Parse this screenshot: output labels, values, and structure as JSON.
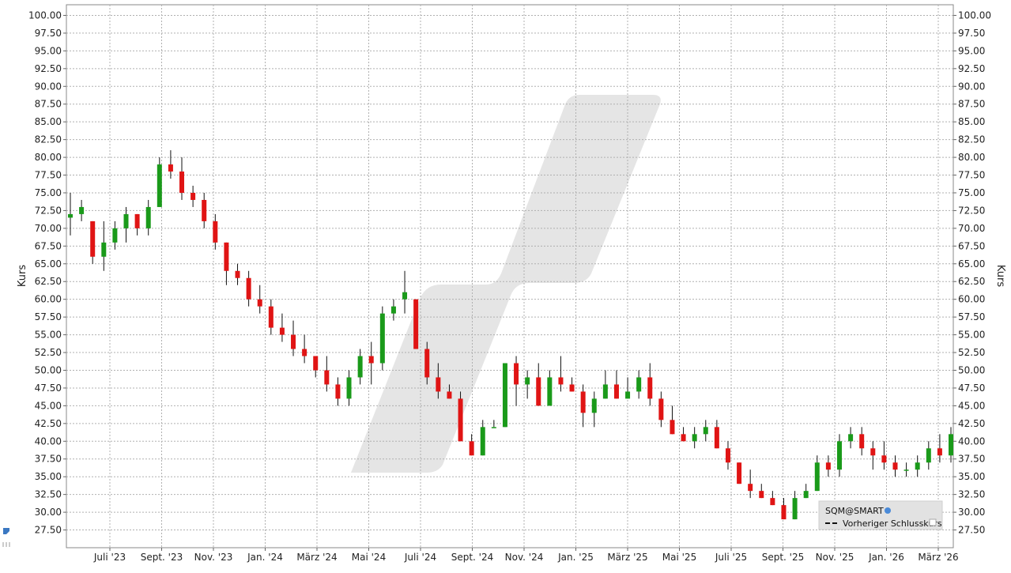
{
  "chart_data": {
    "type": "candlestick",
    "ylabel": "Kurs",
    "ylim": [
      25,
      101.5
    ],
    "y_ticks": [
      "27.50",
      "30.00",
      "32.50",
      "35.00",
      "37.50",
      "40.00",
      "42.50",
      "45.00",
      "47.50",
      "50.00",
      "52.50",
      "55.00",
      "57.50",
      "60.00",
      "62.50",
      "65.00",
      "67.50",
      "70.00",
      "72.50",
      "75.00",
      "77.50",
      "80.00",
      "82.50",
      "85.00",
      "87.50",
      "90.00",
      "92.50",
      "95.00",
      "97.50",
      "100.00"
    ],
    "x_ticks": [
      "Juli '23",
      "Sept. '23",
      "Nov. '23",
      "Jan. '24",
      "März '24",
      "Mai '24",
      "Juli '24",
      "Sept. '24",
      "Nov. '24",
      "Jan. '25",
      "März '25",
      "Mai '25",
      "Juli '25",
      "Sept. '25",
      "Nov. '25",
      "Jan. '26",
      "März '26"
    ],
    "grid": true,
    "legend": {
      "position": "bottom-right",
      "symbol": "SQM@SMART",
      "prev_close_label": "Vorheriger Schlusskurs"
    },
    "colors": {
      "up": "#1a9a1a",
      "down": "#e01414",
      "wick": "#111111",
      "grid": "#b0b0b0"
    },
    "candles": [
      [
        71.5,
        75,
        69,
        72
      ],
      [
        72,
        74,
        71,
        73
      ],
      [
        71,
        71,
        65,
        66
      ],
      [
        66,
        71,
        64,
        68
      ],
      [
        68,
        71,
        67,
        70
      ],
      [
        70,
        73,
        68,
        72
      ],
      [
        72,
        72,
        69,
        70
      ],
      [
        70,
        74,
        69,
        73
      ],
      [
        73,
        80,
        73,
        79
      ],
      [
        79,
        81,
        77,
        78
      ],
      [
        78,
        80,
        74,
        75
      ],
      [
        75,
        76,
        73,
        74
      ],
      [
        74,
        75,
        70,
        71
      ],
      [
        71,
        72,
        67,
        68
      ],
      [
        68,
        68,
        62,
        64
      ],
      [
        64,
        65,
        62,
        63
      ],
      [
        63,
        64,
        59,
        60
      ],
      [
        60,
        62,
        58,
        59
      ],
      [
        59,
        60,
        55,
        56
      ],
      [
        56,
        58,
        54,
        55
      ],
      [
        55,
        57,
        52,
        53
      ],
      [
        53,
        55,
        51,
        52
      ],
      [
        52,
        52,
        49,
        50
      ],
      [
        50,
        52,
        47,
        48
      ],
      [
        48,
        49,
        45,
        46
      ],
      [
        46,
        50,
        45,
        49
      ],
      [
        49,
        53,
        48,
        52
      ],
      [
        52,
        54,
        48,
        51
      ],
      [
        51,
        59,
        50,
        58
      ],
      [
        58,
        60,
        57,
        59
      ],
      [
        60,
        64,
        58,
        61
      ],
      [
        60,
        60,
        53,
        53
      ],
      [
        53,
        54,
        48,
        49
      ],
      [
        49,
        51,
        46,
        47
      ],
      [
        47,
        48,
        46,
        46
      ],
      [
        46,
        47,
        40,
        40
      ],
      [
        40,
        41,
        38,
        38
      ],
      [
        38,
        43,
        38,
        42
      ],
      [
        42,
        43,
        42,
        42
      ],
      [
        42,
        51,
        42,
        51
      ],
      [
        51,
        52,
        45,
        48
      ],
      [
        48,
        50,
        46,
        49
      ],
      [
        49,
        51,
        45,
        45
      ],
      [
        45,
        50,
        45,
        49
      ],
      [
        49,
        52,
        47,
        48
      ],
      [
        48,
        49,
        47,
        47
      ],
      [
        47,
        48,
        42,
        44
      ],
      [
        44,
        47,
        42,
        46
      ],
      [
        46,
        50,
        46,
        48
      ],
      [
        48,
        50,
        46,
        46
      ],
      [
        46,
        49,
        46,
        47
      ],
      [
        47,
        50,
        46,
        49
      ],
      [
        49,
        51,
        45,
        46
      ],
      [
        46,
        47,
        42,
        43
      ],
      [
        43,
        45,
        41,
        41
      ],
      [
        41,
        42,
        40,
        40
      ],
      [
        40,
        42,
        39,
        41
      ],
      [
        41,
        43,
        40,
        42
      ],
      [
        42,
        43,
        39,
        39
      ],
      [
        39,
        40,
        36,
        37
      ],
      [
        37,
        37,
        34,
        34
      ],
      [
        34,
        36,
        32,
        33
      ],
      [
        33,
        34,
        32,
        32
      ],
      [
        32,
        33,
        31,
        31
      ],
      [
        31,
        32,
        29,
        29
      ],
      [
        29,
        33,
        29,
        32
      ],
      [
        32,
        34,
        32,
        33
      ],
      [
        33,
        38,
        33,
        37
      ],
      [
        37,
        38,
        35,
        36
      ],
      [
        36,
        41,
        35,
        40
      ],
      [
        40,
        42,
        39,
        41
      ],
      [
        41,
        42,
        38,
        39
      ],
      [
        39,
        40,
        36,
        38
      ],
      [
        38,
        40,
        36,
        37
      ],
      [
        37,
        38,
        35,
        36
      ],
      [
        36,
        37,
        35,
        36
      ],
      [
        36,
        38,
        35,
        37
      ],
      [
        37,
        40,
        36,
        39
      ],
      [
        39,
        41,
        37,
        38
      ],
      [
        38,
        42,
        37,
        41
      ]
    ]
  }
}
